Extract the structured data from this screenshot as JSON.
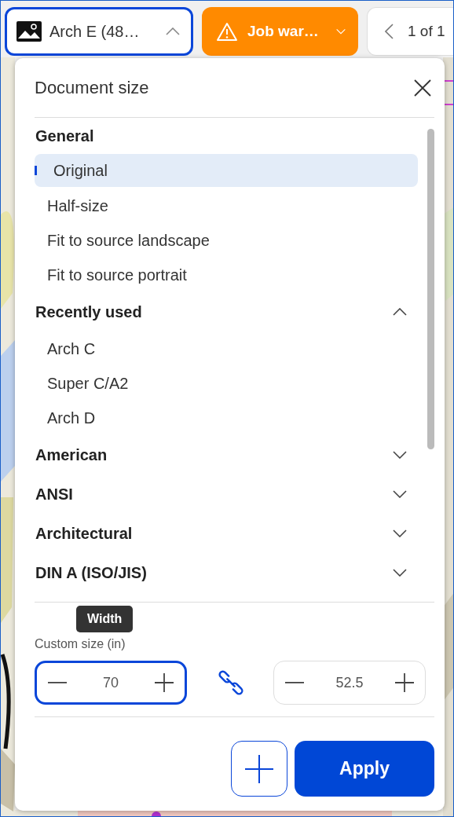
{
  "top_bar": {
    "size_button": {
      "label": "Arch E (48…",
      "expanded": true
    },
    "warning_button": {
      "label": "Job war…"
    },
    "pager": {
      "label": "1 of 1"
    }
  },
  "dialog": {
    "title": "Document size",
    "sections": [
      {
        "title": "General",
        "kind": "plain",
        "items": [
          {
            "label": "Original",
            "selected": true
          },
          {
            "label": "Half-size",
            "selected": false
          },
          {
            "label": "Fit to source landscape",
            "selected": false
          },
          {
            "label": "Fit to source portrait",
            "selected": false
          }
        ]
      },
      {
        "title": "Recently used",
        "kind": "collapsible",
        "expanded": true,
        "items": [
          {
            "label": "Arch C",
            "selected": false
          },
          {
            "label": "Super C/A2",
            "selected": false
          },
          {
            "label": "Arch D",
            "selected": false
          }
        ]
      },
      {
        "title": "American",
        "kind": "collapsible",
        "expanded": false
      },
      {
        "title": "ANSI",
        "kind": "collapsible",
        "expanded": false
      },
      {
        "title": "Architectural",
        "kind": "collapsible",
        "expanded": false
      },
      {
        "title": "DIN A (ISO/JIS)",
        "kind": "collapsible",
        "expanded": false
      }
    ],
    "custom_size": {
      "label": "Custom size (in)",
      "tooltip": "Width",
      "width": {
        "value": "70",
        "focused": true
      },
      "height": {
        "value": "52.5",
        "focused": false
      }
    },
    "apply_button": {
      "label": "Apply"
    }
  }
}
